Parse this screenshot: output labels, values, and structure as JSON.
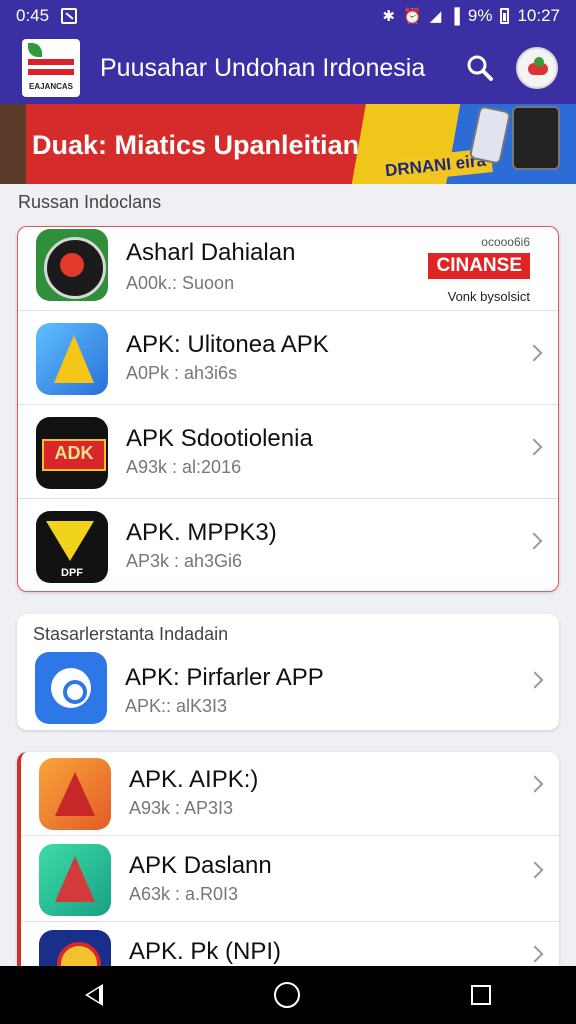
{
  "status_bar": {
    "time": "0:45",
    "battery": "9%",
    "clock": "10:27"
  },
  "app_bar": {
    "title": "Puusahar Undohan Irdonesia",
    "logo_caption": "EAJANCAS"
  },
  "banner": {
    "headline": "Duak: Miatics Upanleitian",
    "subline": "DRNANI eira"
  },
  "sections": [
    {
      "label": "Russan Indoclans",
      "items": [
        {
          "name": "Asharl Dahialan",
          "meta": "A00k.: Suoon",
          "icon": "flower-emblem-icon",
          "ad": {
            "small": "ocooo6i6",
            "logo": "CINANSE",
            "tag": "Vonk bysolsict"
          }
        },
        {
          "name": "APK: Ulitonea APK",
          "meta": "A0Pk : ah3i6s",
          "icon": "triangle-app-icon"
        },
        {
          "name": "APK Sdootiolenia",
          "meta": "A93k : al:2016",
          "icon": "adk-logo-icon"
        },
        {
          "name": "APK. MPPK3)",
          "meta": "AP3k : ah3Gi6",
          "icon": "dpf-triangle-icon"
        }
      ]
    },
    {
      "label": "Stasarlerstanta Indadain",
      "items": [
        {
          "name": "APK: Pirfarler APP",
          "meta": "APK:: alK3I3",
          "icon": "shield-app-icon"
        }
      ]
    },
    {
      "label": "",
      "items": [
        {
          "name": "APK. AIPK:)",
          "meta": "A93k : AP3I3",
          "icon": "red-triangle-icon"
        },
        {
          "name": "APK Daslann",
          "meta": "A63k : a.R0I3",
          "icon": "teal-triangle-icon"
        },
        {
          "name": "APK. Pk (NPI)",
          "meta": "",
          "icon": "badge-app-icon"
        }
      ]
    }
  ],
  "nav_bar": {
    "back": "back-icon",
    "home": "home-icon",
    "recent": "recent-apps-icon"
  }
}
